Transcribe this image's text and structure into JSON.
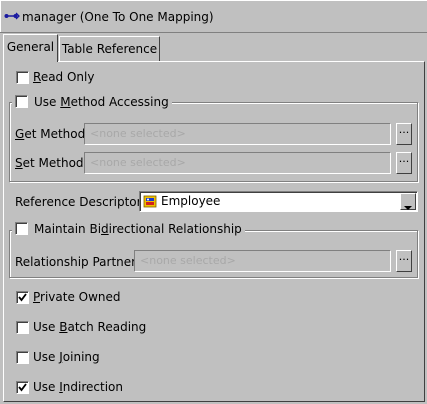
{
  "title": "manager (One To One Mapping)",
  "tabs": [
    {
      "label": "General",
      "selected": true
    },
    {
      "label": "Table Reference",
      "selected": false
    }
  ],
  "read_only": {
    "label_mnemonic": "R",
    "label_rest": "ead Only",
    "checked": false
  },
  "method_accessing": {
    "label_pre": "Use ",
    "label_mnemonic": "M",
    "label_rest": "ethod Accessing",
    "checked": false,
    "get_method": {
      "label_mnemonic": "G",
      "label_rest": "et Method:",
      "value": "<none selected>",
      "button": "..."
    },
    "set_method": {
      "label_mnemonic": "S",
      "label_rest": "et Method:",
      "value": "<none selected>",
      "button": "..."
    }
  },
  "reference_descriptor": {
    "label": "Reference Descriptor:",
    "value": "Employee",
    "icon": "descriptor-icon"
  },
  "bidirectional": {
    "label_pre": "Maintain Bi",
    "label_mnemonic": "d",
    "label_rest": "irectional Relationship",
    "checked": false,
    "relationship_partner": {
      "label": "Relationship Partner:",
      "value": "<none selected>",
      "button": "..."
    }
  },
  "private_owned": {
    "label_mnemonic": "P",
    "label_rest": "rivate Owned",
    "checked": true
  },
  "batch_reading": {
    "label_pre": "Use ",
    "label_mnemonic": "B",
    "label_rest": "atch Reading",
    "checked": false
  },
  "joining": {
    "label_pre": "Use ",
    "label_mnemonic": "J",
    "label_rest": "oining",
    "checked": false
  },
  "indirection": {
    "label_pre": "Use ",
    "label_mnemonic": "I",
    "label_rest": "ndirection",
    "checked": true
  },
  "colors": {
    "background": "#c0c0c0",
    "disabled_text": "#a8a8a8"
  }
}
